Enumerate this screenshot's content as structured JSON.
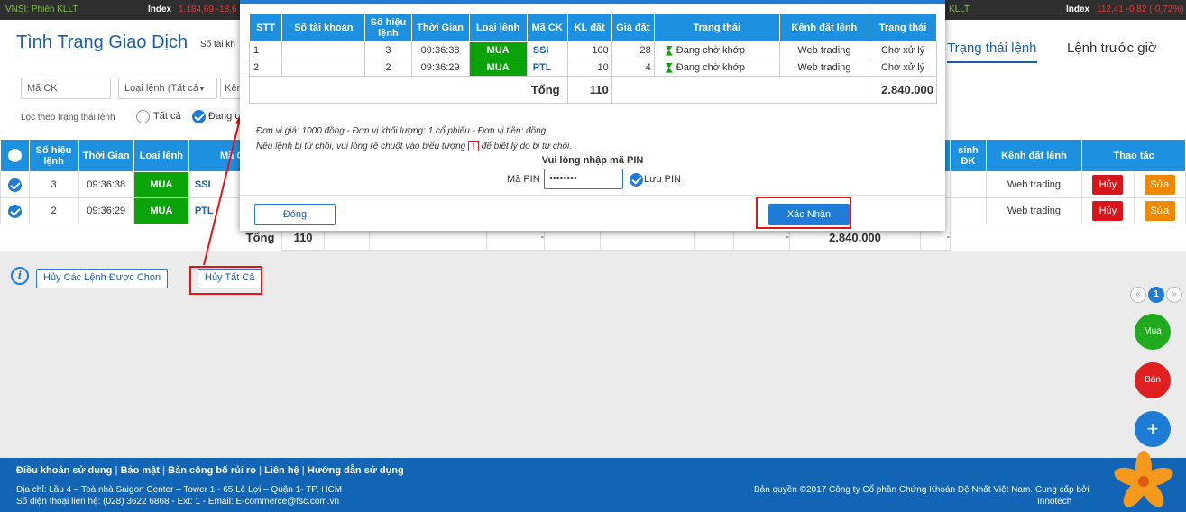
{
  "ticker": {
    "left_label": "VNSI: Phiên KLLT",
    "index_label": "Index",
    "index_value": "1.184,69 -18,6",
    "right_label": "KLLT",
    "right_index_label": "Index",
    "right_index_value": "112,41 -0,82 (-0,72%)"
  },
  "header": {
    "title": "Tình Trạng Giao Dịch",
    "subtitle": "Số tài kh",
    "tabs": [
      "Trạng thái lệnh",
      "Lệnh trước giờ"
    ]
  },
  "filters": {
    "symbol_placeholder": "Mã CK",
    "order_type": "Loại lệnh (Tất cả",
    "channel": "Kên",
    "status_label": "Lọc theo trạng thái lệnh",
    "opt_all": "Tất cả",
    "opt_pending": "Đang c"
  },
  "main_table": {
    "headers": [
      "Số hiệu lệnh",
      "Thời Gian",
      "Loại lệnh",
      "Mã CK",
      "sinh ĐK",
      "Kênh đặt lệnh",
      "Thao tác"
    ],
    "rows": [
      {
        "no": "3",
        "time": "09:36:38",
        "side": "MUA",
        "symbol": "SSI",
        "channel": "Web trading",
        "cancel": "Hủy",
        "edit": "Sửa"
      },
      {
        "no": "2",
        "time": "09:36:29",
        "side": "MUA",
        "symbol": "PTL",
        "channel": "Web trading",
        "cancel": "Hủy",
        "edit": "Sửa"
      }
    ],
    "total_label": "Tổng",
    "total_qty": "110",
    "dash": "-",
    "total_value": "2.840.000"
  },
  "actions": {
    "cancel_selected": "Hủy Các Lệnh Được Chọn",
    "cancel_all": "Hủy Tất Cả"
  },
  "pagination": {
    "prev": "«",
    "current": "1",
    "next": "»"
  },
  "fabs": {
    "buy": "Mua",
    "sell": "Bán",
    "add": "+"
  },
  "colors": {
    "primary": "#1e90e0",
    "buy": "#0aa40a",
    "cancel": "#d9161c",
    "edit": "#ef8a00",
    "footer": "#1264b4"
  },
  "dialog": {
    "headers": [
      "STT",
      "Số tài khoản",
      "Số hiệu lệnh",
      "Thời Gian",
      "Loại lệnh",
      "Mã CK",
      "KL đặt",
      "Giá đặt",
      "Trạng thái",
      "Kênh đặt lệnh",
      "Trạng thái"
    ],
    "rows": [
      {
        "stt": "1",
        "account": "",
        "no": "3",
        "time": "09:36:38",
        "side": "MUA",
        "symbol": "SSI",
        "qty": "100",
        "price": "28",
        "status": "Đang chờ khớp",
        "channel": "Web trading",
        "state": "Chờ xử lý"
      },
      {
        "stt": "2",
        "account": "",
        "no": "2",
        "time": "09:36:29",
        "side": "MUA",
        "symbol": "PTL",
        "qty": "10",
        "price": "4",
        "status": "Đang chờ khớp",
        "channel": "Web trading",
        "state": "Chờ xử lý"
      }
    ],
    "total_label": "Tổng",
    "total_qty": "110",
    "total_value": "2.840.000",
    "note1": "Đơn vị giá: 1000 đồng - Đơn vị khối lượng: 1 cổ phiếu - Đơn vị tiền: đồng",
    "note2a": "Nếu lệnh bị từ chối, vui lòng rê chuột vào biểu tượng",
    "note2_icon": "!",
    "note2b": "để biết lý do bị từ chối.",
    "pin_prompt": "Vui lòng nhập mã PIN",
    "pin_label": "Mã PIN",
    "pin_value": "••••••••",
    "save_pin": "Lưu PIN",
    "close": "Đóng",
    "confirm": "Xác Nhận"
  },
  "footer": {
    "links": [
      "Điều khoản sử dụng",
      "Bảo mật",
      "Bản công bố rủi ro",
      "Liên hệ",
      "Hướng dẫn sử dụng"
    ],
    "address": "Địa chỉ: Lầu 4 – Toà nhà Saigon Center – Tower 1 - 65 Lê Lợi – Quận 1- TP. HCM",
    "phone": "Số điện thoại liên hệ: (028) 3622 6868 - Ext: 1 - Email: E-commerce@fsc.com.vn",
    "copyright": "Bản quyền ©2017 Công ty Cổ phần Chứng Khoán Đệ Nhất Việt Nam. Cung cấp bởi",
    "provider": "Innotech"
  }
}
